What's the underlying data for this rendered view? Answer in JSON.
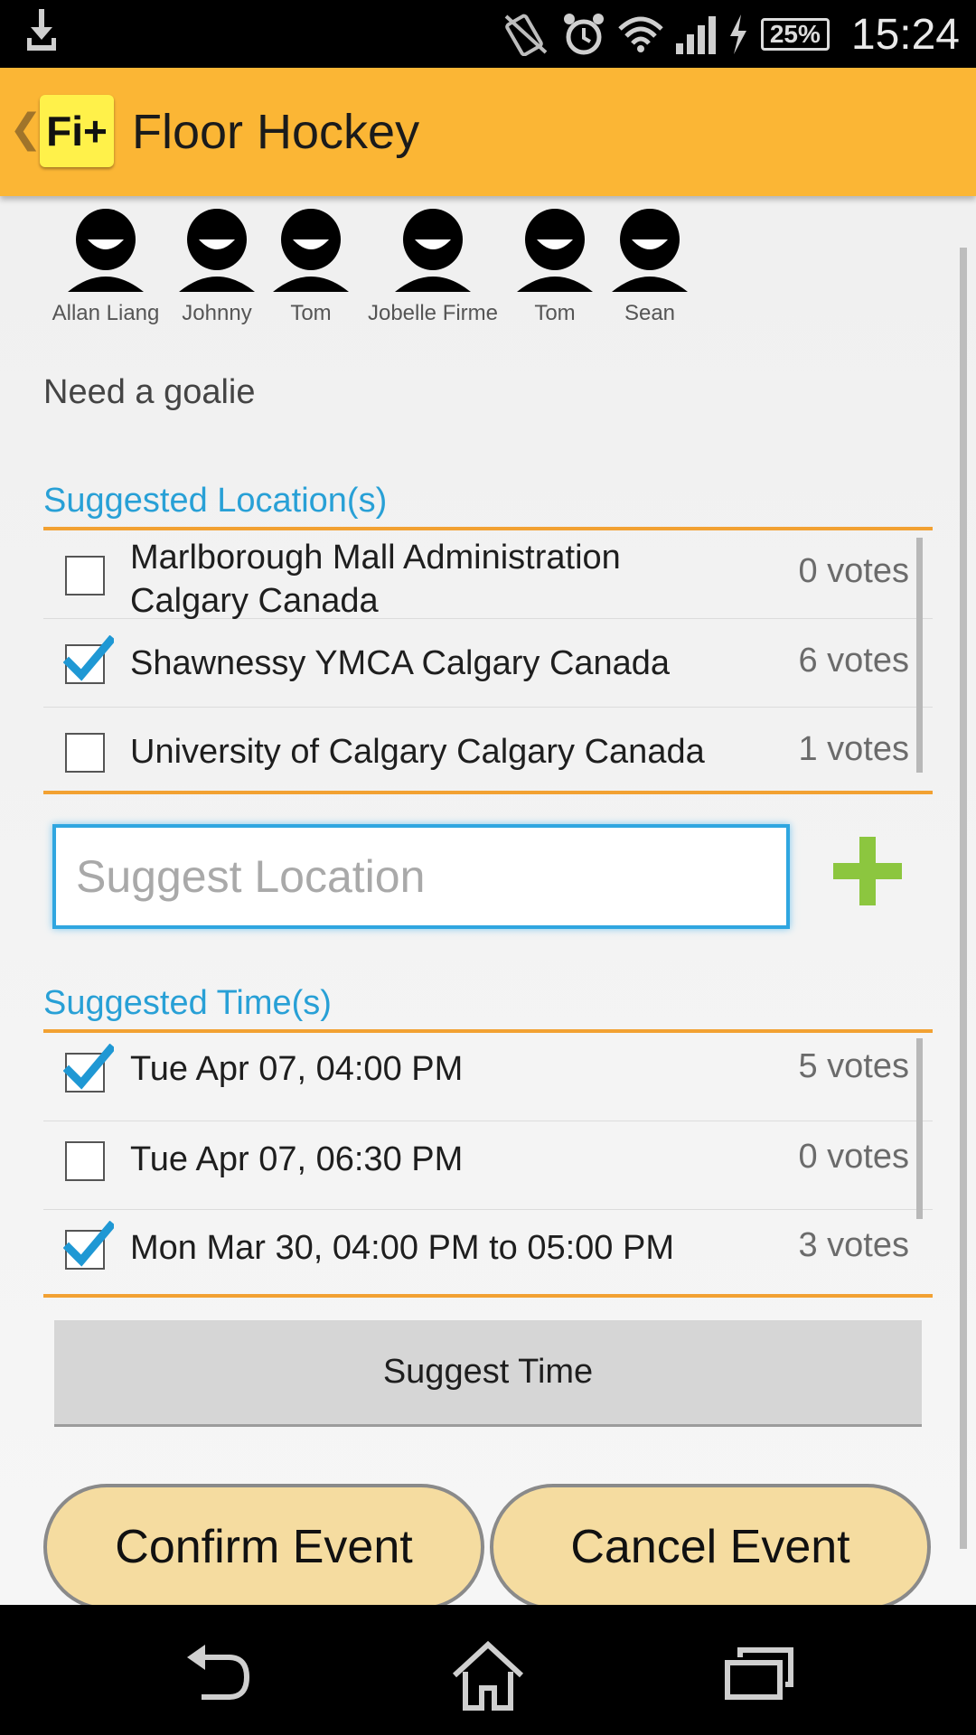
{
  "status_bar": {
    "time": "15:24",
    "battery_percent": "25%",
    "icons": [
      "download-icon",
      "no-rotate-icon",
      "alarm-icon",
      "wifi-icon",
      "signal-icon",
      "charging-icon",
      "battery-icon"
    ]
  },
  "action_bar": {
    "back_glyph": "❮",
    "logo_text": "Fi+",
    "title": "Floor Hockey"
  },
  "members": [
    {
      "name": "Allan Liang"
    },
    {
      "name": "Johnny"
    },
    {
      "name": "Tom"
    },
    {
      "name": "Jobelle Firme"
    },
    {
      "name": "Tom"
    },
    {
      "name": "Sean"
    }
  ],
  "description": "Need a goalie",
  "locations": {
    "title": "Suggested Location(s)",
    "items": [
      {
        "label": "Marlborough Mall Administration Calgary Canada",
        "votes": "0 votes",
        "checked": false
      },
      {
        "label": "Shawnessy YMCA Calgary Canada",
        "votes": "6 votes",
        "checked": true
      },
      {
        "label": "University of Calgary Calgary Canada",
        "votes": "1 votes",
        "checked": false
      }
    ],
    "input_placeholder": "Suggest Location"
  },
  "times": {
    "title": "Suggested Time(s)",
    "items": [
      {
        "label": "Tue Apr 07, 04:00 PM",
        "votes": "5 votes",
        "checked": true
      },
      {
        "label": "Tue Apr 07, 06:30 PM",
        "votes": "0 votes",
        "checked": false
      },
      {
        "label": "Mon Mar 30, 04:00 PM to 05:00 PM",
        "votes": "3 votes",
        "checked": true
      }
    ],
    "suggest_button": "Suggest Time"
  },
  "actions": {
    "confirm": "Confirm Event",
    "cancel": "Cancel Event"
  },
  "colors": {
    "action_bar": "#fbb635",
    "section_title": "#28a0d6",
    "divider": "#f2a132",
    "add_icon": "#8cc63f",
    "pill": "#f5dca0"
  }
}
